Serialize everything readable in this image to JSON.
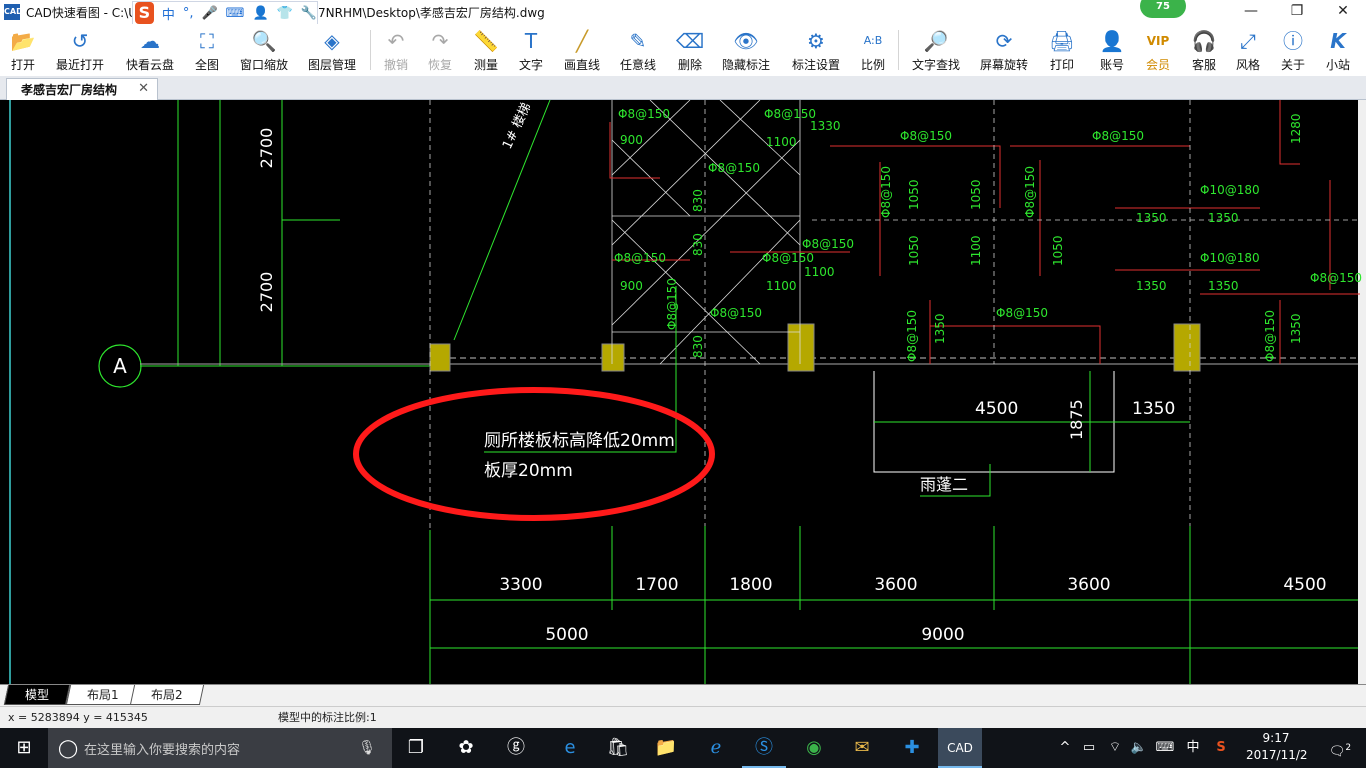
{
  "window": {
    "title": "CAD快速看图 - C:\\U",
    "title_suffix": "7NRHM\\Desktop\\孝感吉宏厂房结构.dwg",
    "logo_text": "CAD",
    "ime_logo": "S",
    "ime_mode": "中",
    "score": "75",
    "minimize": "—",
    "maximize": "❐",
    "close": "✕"
  },
  "toolbar": {
    "buttons": [
      {
        "label": "打开",
        "icon": "folder-icon"
      },
      {
        "label": "最近打开",
        "icon": "history-icon"
      },
      {
        "label": "快看云盘",
        "icon": "cloud-icon"
      },
      {
        "label": "全图",
        "icon": "fit-icon"
      },
      {
        "label": "窗口缩放",
        "icon": "zoom-window-icon"
      },
      {
        "label": "图层管理",
        "icon": "layers-icon"
      },
      {
        "label": "撤销",
        "icon": "undo-icon",
        "disabled": true
      },
      {
        "label": "恢复",
        "icon": "redo-icon",
        "disabled": true
      },
      {
        "label": "测量",
        "icon": "measure-icon"
      },
      {
        "label": "文字",
        "icon": "text-icon"
      },
      {
        "label": "画直线",
        "icon": "line-icon"
      },
      {
        "label": "任意线",
        "icon": "pen-icon"
      },
      {
        "label": "删除",
        "icon": "eraser-icon"
      },
      {
        "label": "隐藏标注",
        "icon": "eye-icon"
      },
      {
        "label": "标注设置",
        "icon": "settings-icon"
      },
      {
        "label": "比例",
        "icon": "scale-icon"
      },
      {
        "label": "文字查找",
        "icon": "text-search-icon"
      },
      {
        "label": "屏幕旋转",
        "icon": "rotate-icon"
      },
      {
        "label": "打印",
        "icon": "print-icon"
      },
      {
        "label": "账号",
        "icon": "user-icon"
      },
      {
        "label": "会员",
        "icon": "vip-icon"
      },
      {
        "label": "客服",
        "icon": "headset-icon"
      },
      {
        "label": "风格",
        "icon": "style-icon"
      },
      {
        "label": "关于",
        "icon": "info-icon"
      },
      {
        "label": "小站",
        "icon": "station-icon"
      }
    ]
  },
  "document_tab": {
    "label": "孝感吉宏厂房结构",
    "close": "✕"
  },
  "drawing": {
    "axis_label": "A",
    "stair_label": "1# 楼梯",
    "dims_vertical": [
      "2700",
      "2700"
    ],
    "rebar_labels": [
      "Φ8@150",
      "Φ8@150",
      "Φ8@150",
      "Φ8@150",
      "Φ8@150",
      "Φ8@150",
      "Φ8@150",
      "Φ8@150",
      "Φ8@150",
      "Φ8@150",
      "Φ8@150",
      "Φ8@150",
      "Φ10@180",
      "Φ10@180",
      "Φ8@150",
      "Φ8@150",
      "Φ8@150",
      "Φ8@150"
    ],
    "span_labels": [
      "900",
      "830",
      "1100",
      "1330",
      "900",
      "1100",
      "830",
      "1050",
      "1050",
      "1050",
      "1050",
      "1350",
      "1350",
      "1350",
      "1350",
      "1350",
      "1280",
      "1100",
      "1350",
      "830",
      "1100"
    ],
    "note_line1": "厕所楼板标高降低20mm",
    "note_line2": "板厚20mm",
    "canopy_dims": [
      "4500",
      "1350",
      "1875"
    ],
    "canopy_label": "雨蓬二",
    "bottom_dims_row1": [
      "3300",
      "1700",
      "1800",
      "3600",
      "3600",
      "4500"
    ],
    "bottom_dims_row2": [
      "5000",
      "9000"
    ]
  },
  "layout_tabs": [
    "模型",
    "布局1",
    "布局2"
  ],
  "status": {
    "coords": "x = 5283894  y = 415345",
    "scale_info": "模型中的标注比例:1"
  },
  "taskbar": {
    "start_icon": "⊞",
    "search_placeholder": "在这里输入你要搜索的内容",
    "ime_indicator": "中",
    "time": "9:17",
    "date": "2017/11/2",
    "notification_count": "2"
  }
}
